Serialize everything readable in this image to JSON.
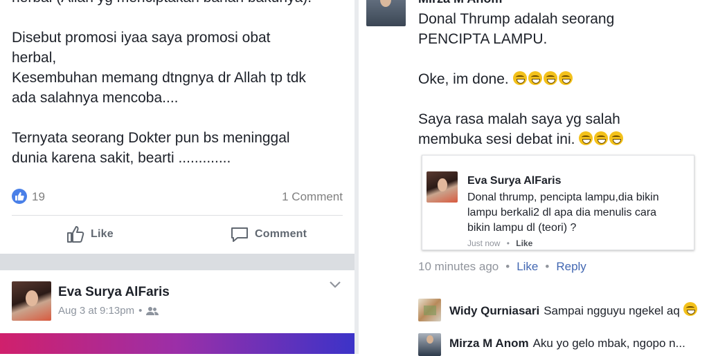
{
  "post": {
    "text_blocks": [
      "herbal (Allah yg menciptakan bahan bakunya).",
      "Disebut promosi iyaa saya promosi obat\nherbal,\nKesembuhan memang dtngnya dr Allah tp tdk\nada salahnya mencoba....",
      "Ternyata seorang Dokter pun bs meninggal\ndunia karena sakit, bearti ............."
    ],
    "like_count": "19",
    "comment_count": "1 Comment",
    "like_label": "Like",
    "comment_label": "Comment"
  },
  "post2": {
    "author": "Eva Surya AlFaris",
    "timestamp": "Aug 3 at 9:13pm",
    "separator": "•"
  },
  "comment": {
    "author_top": "Mirza M Anom",
    "paragraphs": [
      "Donal Thrump adalah seorang\nPENCIPTA LAMPU.",
      "Oke, im done.",
      "Saya rasa malah saya yg salah\nmembuka sesi debat ini."
    ],
    "quote": {
      "author": "Eva Surya AlFaris",
      "text": "Donal thrump, pencipta lampu,dia bikin\nlampu berkali2 dl apa dia menulis cara\nbikin lampu dl (teori) ?",
      "time": "Just now",
      "sep": "•",
      "like": "Like"
    },
    "time": "10 minutes ago",
    "sep": "•",
    "like_label": "Like",
    "reply_label": "Reply"
  },
  "replies": [
    {
      "name": "Widy Qurniasari",
      "text": "Sampai ngguyu ngekel aq"
    },
    {
      "name": "Mirza M Anom",
      "text": "Aku yo gelo mbak, ngopo n..."
    }
  ],
  "colors": {
    "like_blue": "#4a80e8",
    "link_blue": "#4267b2",
    "brand_gradient": [
      "#d0206c",
      "#3c33c8"
    ]
  }
}
